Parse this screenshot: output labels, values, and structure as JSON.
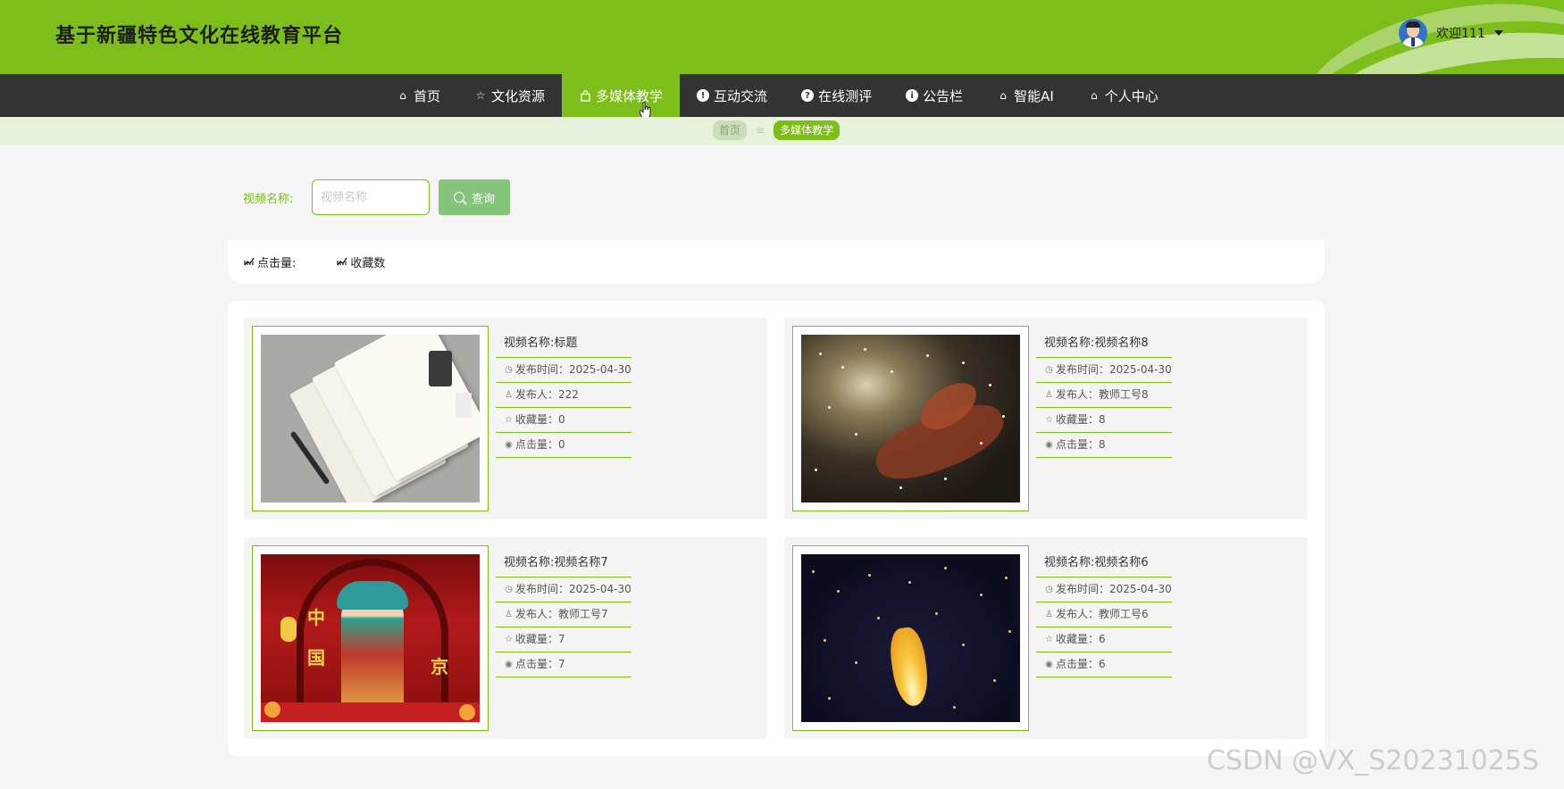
{
  "header": {
    "site_title": "基于新疆特色文化在线教育平台",
    "welcome": "欢迎111"
  },
  "nav": {
    "items": [
      {
        "label": "首页",
        "icon": "home-icon"
      },
      {
        "label": "文化资源",
        "icon": "star-icon"
      },
      {
        "label": "多媒体教学",
        "icon": "bag-icon",
        "active": true
      },
      {
        "label": "互动交流",
        "icon": "alert-circle-icon"
      },
      {
        "label": "在线测评",
        "icon": "question-circle-icon"
      },
      {
        "label": "公告栏",
        "icon": "info-circle-icon"
      },
      {
        "label": "智能AI",
        "icon": "home-icon"
      },
      {
        "label": "个人中心",
        "icon": "home-icon"
      }
    ]
  },
  "breadcrumb": {
    "home": "首页",
    "separator": "≡",
    "current": "多媒体教学"
  },
  "search": {
    "label": "视频名称:",
    "placeholder": "视频名称",
    "button": "查询"
  },
  "sort": {
    "clicks": "点击量:",
    "favorites": "收藏数"
  },
  "cards": [
    {
      "title": "视频名称:标题",
      "publish_time": "发布时间：2025-04-30",
      "publisher": "发布人：222",
      "favorites": "收藏量：0",
      "clicks": "点击量：0",
      "image": "notebooks-and-pen"
    },
    {
      "title": "视频名称:视频名称8",
      "publish_time": "发布时间：2025-04-30",
      "publisher": "发布人：教师工号8",
      "favorites": "收藏量：8",
      "clicks": "点击量：8",
      "image": "fireworks-dragon-dance"
    },
    {
      "title": "视频名称:视频名称7",
      "publish_time": "发布时间：2025-04-30",
      "publisher": "发布人：教师工号7",
      "favorites": "收藏量：7",
      "clicks": "点击量：7",
      "image": "peking-opera-performer"
    },
    {
      "title": "视频名称:视频名称6",
      "publish_time": "发布时间：2025-04-30",
      "publisher": "发布人：教师工号6",
      "favorites": "收藏量：6",
      "clicks": "点击量：6",
      "image": "sky-lanterns-night"
    }
  ],
  "watermark": "CSDN @VX_S20231025S",
  "colors": {
    "brand_green": "#7dbe1a",
    "nav_dark": "#333333",
    "button_green": "#85c47b",
    "breadcrumb_bg": "#e7f2dc"
  }
}
